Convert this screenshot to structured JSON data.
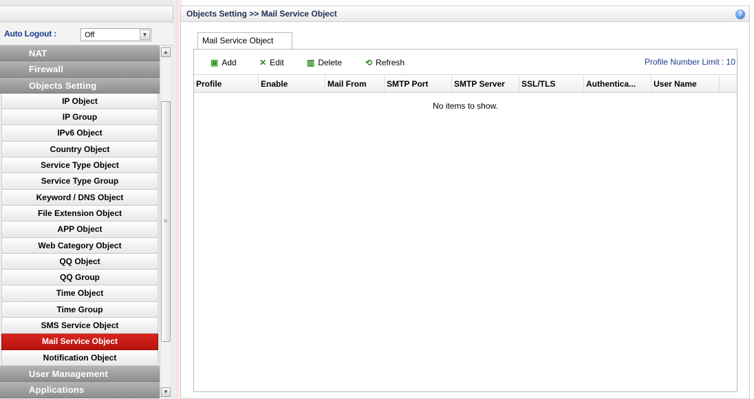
{
  "sidebar": {
    "auto_logout_label": "Auto Logout :",
    "auto_logout_value": "Off",
    "items": [
      {
        "label": "NAT",
        "type": "category"
      },
      {
        "label": "Firewall",
        "type": "category"
      },
      {
        "label": "Objects Setting",
        "type": "category"
      },
      {
        "label": "IP Object",
        "type": "sub"
      },
      {
        "label": "IP Group",
        "type": "sub"
      },
      {
        "label": "IPv6 Object",
        "type": "sub"
      },
      {
        "label": "Country Object",
        "type": "sub"
      },
      {
        "label": "Service Type Object",
        "type": "sub"
      },
      {
        "label": "Service Type Group",
        "type": "sub"
      },
      {
        "label": "Keyword / DNS Object",
        "type": "sub"
      },
      {
        "label": "File Extension Object",
        "type": "sub"
      },
      {
        "label": "APP Object",
        "type": "sub"
      },
      {
        "label": "Web Category Object",
        "type": "sub"
      },
      {
        "label": "QQ Object",
        "type": "sub"
      },
      {
        "label": "QQ Group",
        "type": "sub"
      },
      {
        "label": "Time Object",
        "type": "sub"
      },
      {
        "label": "Time Group",
        "type": "sub"
      },
      {
        "label": "SMS Service Object",
        "type": "sub"
      },
      {
        "label": "Mail Service Object",
        "type": "sub",
        "active": true
      },
      {
        "label": "Notification Object",
        "type": "sub"
      },
      {
        "label": "User Management",
        "type": "category"
      },
      {
        "label": "Applications",
        "type": "category"
      }
    ]
  },
  "page": {
    "breadcrumb": "Objects Setting >> Mail Service Object",
    "help_icon": "?",
    "tab_label": "Mail Service Object"
  },
  "toolbar": {
    "add": "Add",
    "edit": "Edit",
    "delete": "Delete",
    "refresh": "Refresh",
    "limit": "Profile Number Limit : 10"
  },
  "table": {
    "columns": [
      "Profile",
      "Enable",
      "Mail From",
      "SMTP Port",
      "SMTP Server",
      "SSL/TLS",
      "Authentica...",
      "User Name"
    ],
    "empty_text": "No items to show."
  },
  "colors": {
    "active_item": "#c81d17",
    "category_bg": "#9e9e9e",
    "link_blue": "#1b3d8c"
  }
}
